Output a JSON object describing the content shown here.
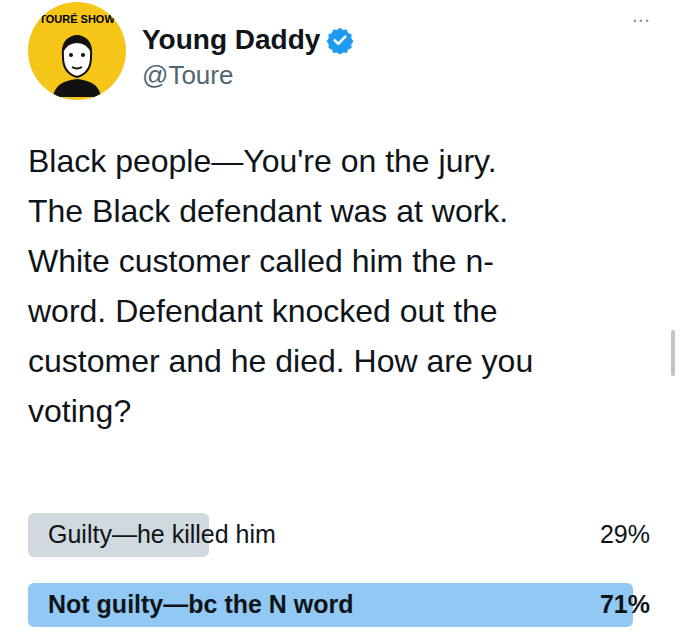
{
  "author": {
    "avatar_label": "TOURÉ SHOW",
    "name": "Young Daddy",
    "verified": true,
    "handle": "@Toure"
  },
  "menu": "...",
  "tweet": {
    "lines": [
      "Black people—You're on the jury.",
      "The Black defendant was at work.",
      "White customer called him the n-",
      "word. Defendant knocked out the",
      "customer and he died. How are you",
      "voting?"
    ]
  },
  "poll": {
    "options": [
      {
        "label": "Guilty—he killed him",
        "percent": "29%",
        "level": 0.29,
        "leading": false
      },
      {
        "label": "Not guilty—bc the N word",
        "percent": "71%",
        "level": 0.97,
        "leading": true
      }
    ]
  }
}
